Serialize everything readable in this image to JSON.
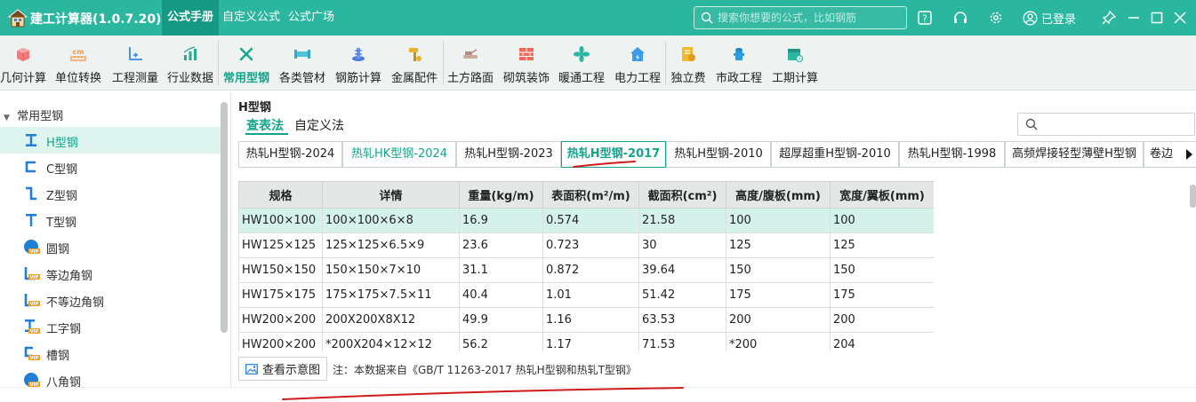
{
  "app": {
    "title": "建工计算器(1.0.7.20)",
    "nav_tabs": [
      {
        "label": "公式手册",
        "active": true
      },
      {
        "label": "自定义公式",
        "active": false
      },
      {
        "label": "公式广场",
        "active": false
      }
    ],
    "search_placeholder": "搜索你想要的公式，比如钢筋",
    "login_label": "已登录",
    "brand_color": "#2bb69f"
  },
  "toolbar": {
    "items": [
      {
        "label": "几何计算",
        "icon": "cube-icon"
      },
      {
        "label": "单位转换",
        "icon": "cm-ruler-icon"
      },
      {
        "label": "工程测量",
        "icon": "axis-measure-icon"
      },
      {
        "label": "行业数据",
        "icon": "bar-chart-icon"
      },
      {
        "label": "常用型钢",
        "icon": "wrench-cross-icon",
        "active": true
      },
      {
        "label": "各类管材",
        "icon": "pipe-icon"
      },
      {
        "label": "钢筋计算",
        "icon": "rebar-icon"
      },
      {
        "label": "金属配件",
        "icon": "hammer-icon"
      },
      {
        "label": "土方路面",
        "icon": "excavator-icon"
      },
      {
        "label": "砌筑装饰",
        "icon": "brick-wall-icon"
      },
      {
        "label": "暖通工程",
        "icon": "fan-icon"
      },
      {
        "label": "电力工程",
        "icon": "power-house-icon"
      },
      {
        "label": "独立费",
        "icon": "fee-icon"
      },
      {
        "label": "市政工程",
        "icon": "hydrant-icon"
      },
      {
        "label": "工期计算",
        "icon": "calendar-icon"
      }
    ]
  },
  "tree": {
    "root": "常用型钢",
    "items": [
      {
        "label": "H型钢",
        "icon": "h-beam-icon",
        "active": true
      },
      {
        "label": "C型钢",
        "icon": "c-channel-icon"
      },
      {
        "label": "Z型钢",
        "icon": "z-section-icon"
      },
      {
        "label": "T型钢",
        "icon": "t-section-icon"
      },
      {
        "label": "圆钢",
        "icon": "round-bar-vip-icon"
      },
      {
        "label": "等边角钢",
        "icon": "angle-equal-vip-icon"
      },
      {
        "label": "不等边角钢",
        "icon": "angle-unequal-vip-icon"
      },
      {
        "label": "工字钢",
        "icon": "i-beam-vip-icon"
      },
      {
        "label": "槽钢",
        "icon": "channel-vip-icon"
      },
      {
        "label": "八角钢",
        "icon": "octagon-vip-icon"
      }
    ],
    "vip_badge": "VIP"
  },
  "main": {
    "title": "H型钢",
    "method_tabs": [
      {
        "label": "查表法",
        "active": true
      },
      {
        "label": "自定义法",
        "active": false
      }
    ],
    "spec_tabs": [
      {
        "label": "热轧H型钢-2024",
        "state": "normal"
      },
      {
        "label": "热轧HK型钢-2024",
        "state": "green"
      },
      {
        "label": "热轧H型钢-2023",
        "state": "normal"
      },
      {
        "label": "热轧H型钢-2017",
        "state": "active"
      },
      {
        "label": "热轧H型钢-2010",
        "state": "normal"
      },
      {
        "label": "超厚超重H型钢-2010",
        "state": "normal"
      },
      {
        "label": "热轧H型钢-1998",
        "state": "normal"
      },
      {
        "label": "高频焊接轻型薄壁H型钢",
        "state": "normal"
      },
      {
        "label": "卷边",
        "state": "normal"
      }
    ],
    "table": {
      "headers": [
        "规格",
        "详情",
        "重量(kg/m)",
        "表面积(m²/m)",
        "截面积(cm²)",
        "高度/腹板(mm)",
        "宽度/翼板(mm)"
      ],
      "rows": [
        [
          "HW100×100",
          "100×100×6×8",
          "16.9",
          "0.574",
          "21.58",
          "100",
          "100"
        ],
        [
          "HW125×125",
          "125×125×6.5×9",
          "23.6",
          "0.723",
          "30",
          "125",
          "125"
        ],
        [
          "HW150×150",
          "150×150×7×10",
          "31.1",
          "0.872",
          "39.64",
          "150",
          "150"
        ],
        [
          "HW175×175",
          "175×175×7.5×11",
          "40.4",
          "1.01",
          "51.42",
          "175",
          "175"
        ],
        [
          "HW200×200",
          "200X200X8X12",
          "49.9",
          "1.16",
          "63.53",
          "200",
          "200"
        ],
        [
          "HW200×200",
          "*200X204×12×12",
          "56.2",
          "1.17",
          "71.53",
          "*200",
          "204"
        ]
      ],
      "selected_row": 0
    },
    "view_button": "查看示意图",
    "note": "注：本数据来自《GB/T 11263-2017 热轧H型钢和热轧T型钢》"
  }
}
